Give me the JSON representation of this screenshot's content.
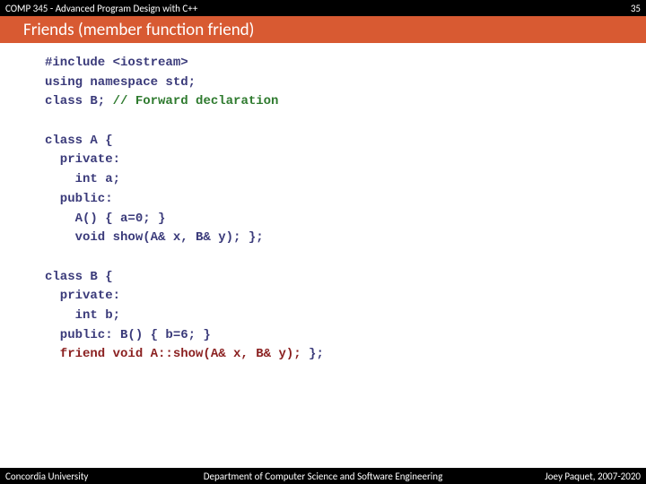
{
  "header": {
    "course": "COMP 345 - Advanced Program Design with C++",
    "page_number": "35"
  },
  "title": "Friends (member function friend)",
  "code": {
    "l01": "#include <iostream>",
    "l02": "using namespace std;",
    "l03a": "class B; ",
    "l03b": "// Forward declaration",
    "l04": "",
    "l05": "class A {",
    "l06": "  private:",
    "l07": "    int a;",
    "l08": "  public:",
    "l09": "    A() { a=0; }",
    "l10": "    void show(A& x, B& y); };",
    "l11": "",
    "l12": "class B {",
    "l13": "  private:",
    "l14": "    int b;",
    "l15": "  public: B() { b=6; }",
    "l16a": "  friend void A::show(A& x, B& y);",
    "l16b": " };"
  },
  "footer": {
    "left": "Concordia University",
    "center": "Department of Computer Science and Software Engineering",
    "right": "Joey Paquet, 2007-2020"
  }
}
